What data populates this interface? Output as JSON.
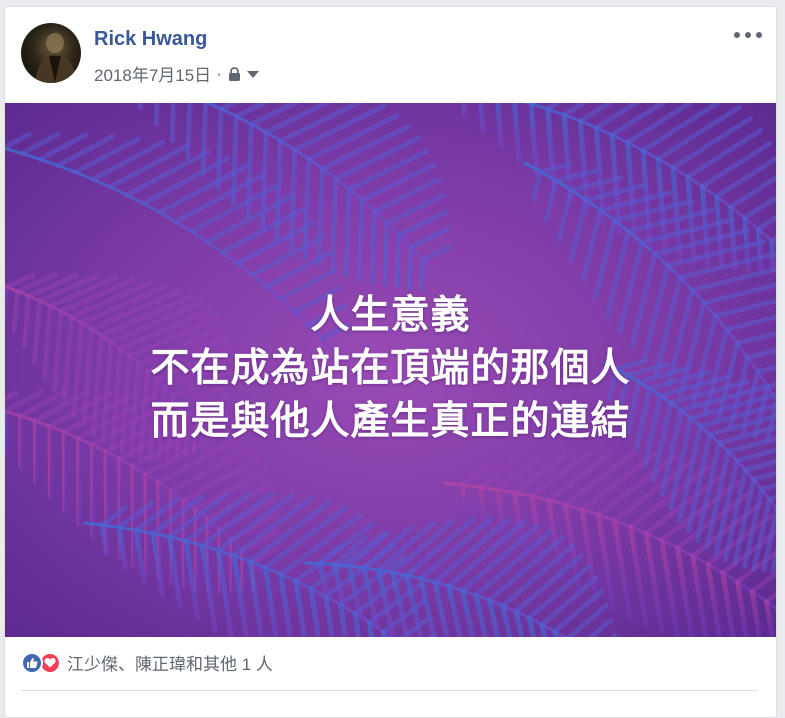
{
  "post": {
    "author": "Rick Hwang",
    "date": "2018年7月15日",
    "separator": "·",
    "privacy_icon": "lock-icon",
    "audience_menu_icon": "caret-down-icon",
    "more_icon": "ellipsis-icon"
  },
  "image": {
    "line1": "人生意義",
    "line2": "不在成為站在頂端的那個人",
    "line3": "而是與他人產生真正的連結",
    "colors": {
      "base": "#7a3aa6",
      "leaf_blue": "#3c6fd6",
      "leaf_pink": "#c2459e"
    }
  },
  "reactions": {
    "icons": [
      "like-icon",
      "love-icon"
    ],
    "text": "江少傑、陳正瑋和其他 1 人"
  }
}
